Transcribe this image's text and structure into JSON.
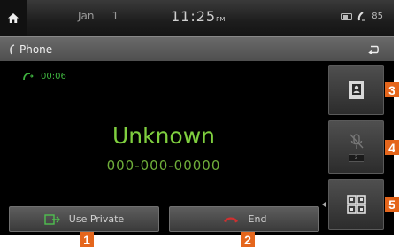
{
  "status_bar": {
    "date_month": "Jan",
    "date_day": "1",
    "time": "11:25",
    "time_suffix": "PM",
    "battery_text": "85"
  },
  "title_bar": {
    "title": "Phone"
  },
  "call": {
    "duration": "00:06",
    "caller_name": "Unknown",
    "caller_number": "000-000-00000"
  },
  "side_buttons": {
    "mute_state": "3"
  },
  "bottom_buttons": {
    "use_private_label": "Use Private",
    "end_label": "End"
  },
  "callouts": {
    "c1": "1",
    "c2": "2",
    "c3": "3",
    "c4": "4",
    "c5": "5"
  },
  "colors": {
    "accent_green": "#7fcf3f",
    "callout_orange": "#e5661c",
    "end_red": "#d03030"
  },
  "icons": [
    "home-icon",
    "bluetooth-icon",
    "signal-icon",
    "phone-icon",
    "back-icon",
    "call-active-icon",
    "contacts-icon",
    "mic-mute-icon",
    "keypad-icon",
    "private-mode-icon",
    "end-call-icon"
  ]
}
